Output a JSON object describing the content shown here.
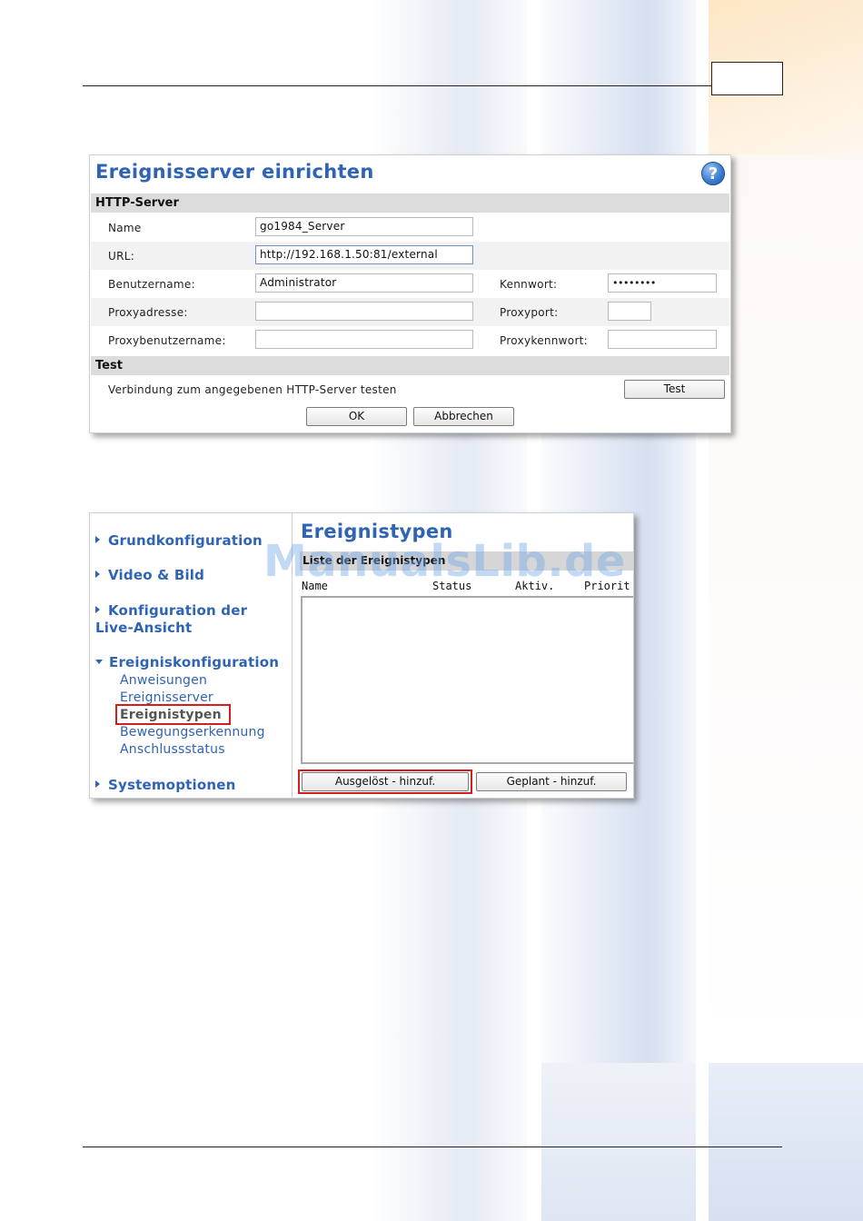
{
  "panel1": {
    "title": "Ereignisserver einrichten",
    "help_icon": "question-mark-icon",
    "http_section": "HTTP-Server",
    "fields": {
      "name_label": "Name",
      "name_value": "go1984_Server",
      "url_label": "URL:",
      "url_value": "http://192.168.1.50:81/external",
      "username_label": "Benutzername:",
      "username_value": "Administrator",
      "password_label": "Kennwort:",
      "password_value": "••••••••",
      "proxy_address_label": "Proxyadresse:",
      "proxy_address_value": "",
      "proxy_port_label": "Proxyport:",
      "proxy_port_value": "",
      "proxy_user_label": "Proxybenutzername:",
      "proxy_user_value": "",
      "proxy_password_label": "Proxykennwort:",
      "proxy_password_value": ""
    },
    "test_section": "Test",
    "test_text": "Verbindung zum angegebenen HTTP-Server testen",
    "test_button": "Test",
    "ok_button": "OK",
    "cancel_button": "Abbrechen"
  },
  "panel2": {
    "nav": {
      "grundkonfiguration": "Grundkonfiguration",
      "video_bild": "Video & Bild",
      "live_line1": "Konfiguration der",
      "live_line2": "Live-Ansicht",
      "ereigniskonfiguration": "Ereigniskonfiguration",
      "sub": [
        "Anweisungen",
        "Ereignisserver",
        "Ereignistypen",
        "Bewegungserkennung",
        "Anschlussstatus"
      ],
      "systemoptionen": "Systemoptionen"
    },
    "title": "Ereignistypen",
    "list_header": "Liste der Ereignistypen",
    "columns": [
      "Name",
      "Status",
      "Aktiv.",
      "Priorit"
    ],
    "triggered_button": "Ausgelöst - hinzuf.",
    "scheduled_button": "Geplant - hinzuf."
  },
  "watermark": "ManualsLib.de",
  "colors": {
    "accent_blue": "#2f63b3",
    "highlight_red": "#d21e1e",
    "section_gray": "#dcdcdc"
  }
}
